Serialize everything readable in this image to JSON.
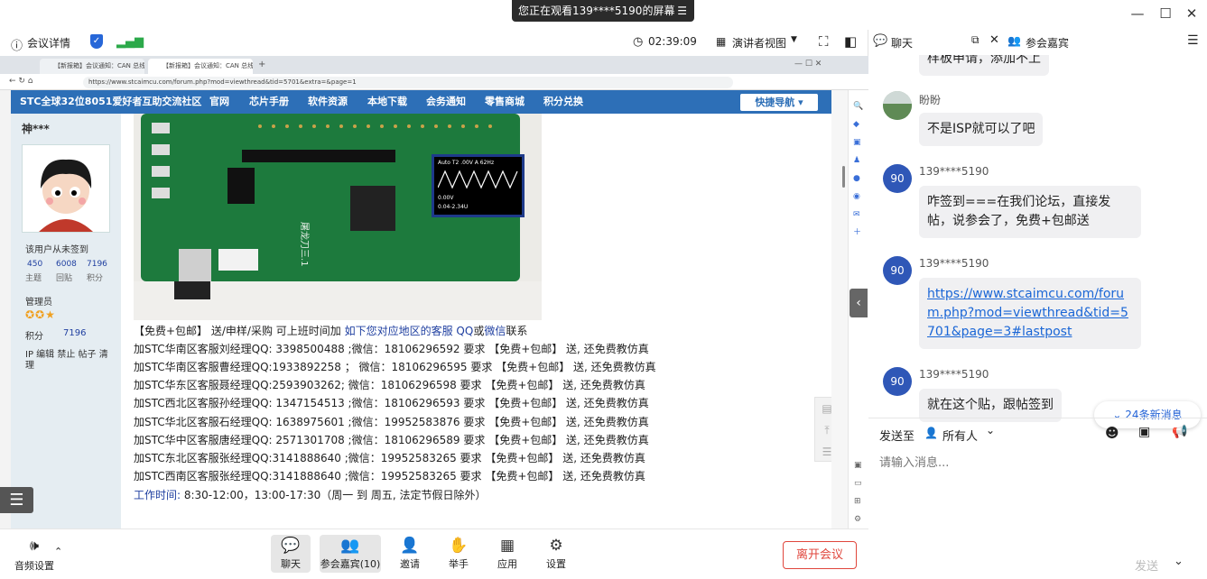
{
  "banner": {
    "text": "您正在观看139****5190的屏幕",
    "menu_icon": "menu-icon"
  },
  "toolbar": {
    "meeting_info": "会议详情",
    "timer": "02:39:09",
    "view_mode": "演讲者视图"
  },
  "browser": {
    "tabs": [
      "【新报箱】会议通知：CAN 总线",
      "【新报箱】会议通知：CAN 总线"
    ],
    "url": "https://www.stcaimcu.com/forum.php?mod=viewthread&tid=5701&extra=&page=1"
  },
  "site": {
    "logo": "STC全球32位8051爱好者互助交流社区",
    "nav": [
      "官网",
      "芯片手册",
      "软件资源",
      "本地下载",
      "会务通知",
      "零售商城",
      "积分兑换"
    ],
    "quick_nav": "快捷导航 ▾",
    "profile": {
      "username": "神***",
      "signin": "该用户从未签到",
      "stats": [
        {
          "value": "450",
          "label": "主题"
        },
        {
          "value": "6008",
          "label": "回贴"
        },
        {
          "value": "7196",
          "label": "积分"
        }
      ],
      "role": "管理员",
      "points_label": "积分",
      "points_value": "7196",
      "actions": "IP 编辑 禁止 帖子 清理"
    },
    "board": {
      "screen_line1": "Auto  T2 .00V  A 62Hz",
      "screen_line2": "0.00V",
      "screen_line3": "0.04-2.34U",
      "silk": "屠龙刀三.1"
    },
    "intro": {
      "prefix": "【免费+包邮】 送/申样/采购 可上班时间加 ",
      "link": "如下您对应地区的客服 QQ",
      "mid": "或",
      "wechat": "微信",
      "suffix": "联系"
    },
    "contacts": [
      "加STC华南区客服刘经理QQ: 3398500488 ;微信：18106296592  要求 【免费+包邮】 送, 还免费教仿真",
      "加STC华南区客服曹经理QQ:1933892258 ； 微信：18106296595 要求 【免费+包邮】 送, 还免费教仿真",
      "加STC华东区客服聂经理QQ:2593903262; 微信：18106296598  要求 【免费+包邮】 送, 还免费教仿真",
      "加STC西北区客服孙经理QQ: 1347154513 ;微信：18106296593  要求 【免费+包邮】 送, 还免费教仿真",
      "加STC华北区客服石经理QQ: 1638975601 ;微信：19952583876  要求 【免费+包邮】 送, 还免费教仿真",
      "加STC华中区客服唐经理QQ:  2571301708 ;微信：18106296589  要求 【免费+包邮】 送, 还免费教仿真",
      "加STC东北区客服张经理QQ:3141888640 ;微信：19952583265   要求 【免费+包邮】 送, 还免费教仿真",
      "加STC西南区客服张经理QQ:3141888640 ;微信：19952583265   要求 【免费+包邮】 送, 还免费教仿真"
    ],
    "hours_label": "工作时间:",
    "hours_value": " 8:30-12:00，13:00-17:30（周一 到 周五, 法定节假日除外）"
  },
  "bottombar": {
    "audio": "音频设置",
    "buttons": [
      "聊天",
      "参会嘉宾(10)",
      "邀请",
      "举手",
      "应用",
      "设置"
    ],
    "leave": "离开会议"
  },
  "chat": {
    "tab_chat": "聊天",
    "tab_participants": "参会嘉宾",
    "partial_msg": "样板申请，添加不上",
    "messages": [
      {
        "sender": "盼盼",
        "text": "不是ISP就可以了吧"
      },
      {
        "sender": "139****5190",
        "avatar": "90",
        "text": "咋签到===在我们论坛，直接发帖，说参会了，免费+包邮送"
      },
      {
        "sender": "139****5190",
        "avatar": "90",
        "text": "https://www.stcaimcu.com/forum.php?mod=viewthread&tid=5701&page=3#lastpost"
      },
      {
        "sender": "139****5190",
        "avatar": "90",
        "text": "就在这个贴，跟帖签到"
      }
    ],
    "new_messages": "24条新消息",
    "send_to_label": "发送至",
    "send_to_value": "所有人",
    "input_placeholder": "请输入消息...",
    "send_button": "发送"
  }
}
